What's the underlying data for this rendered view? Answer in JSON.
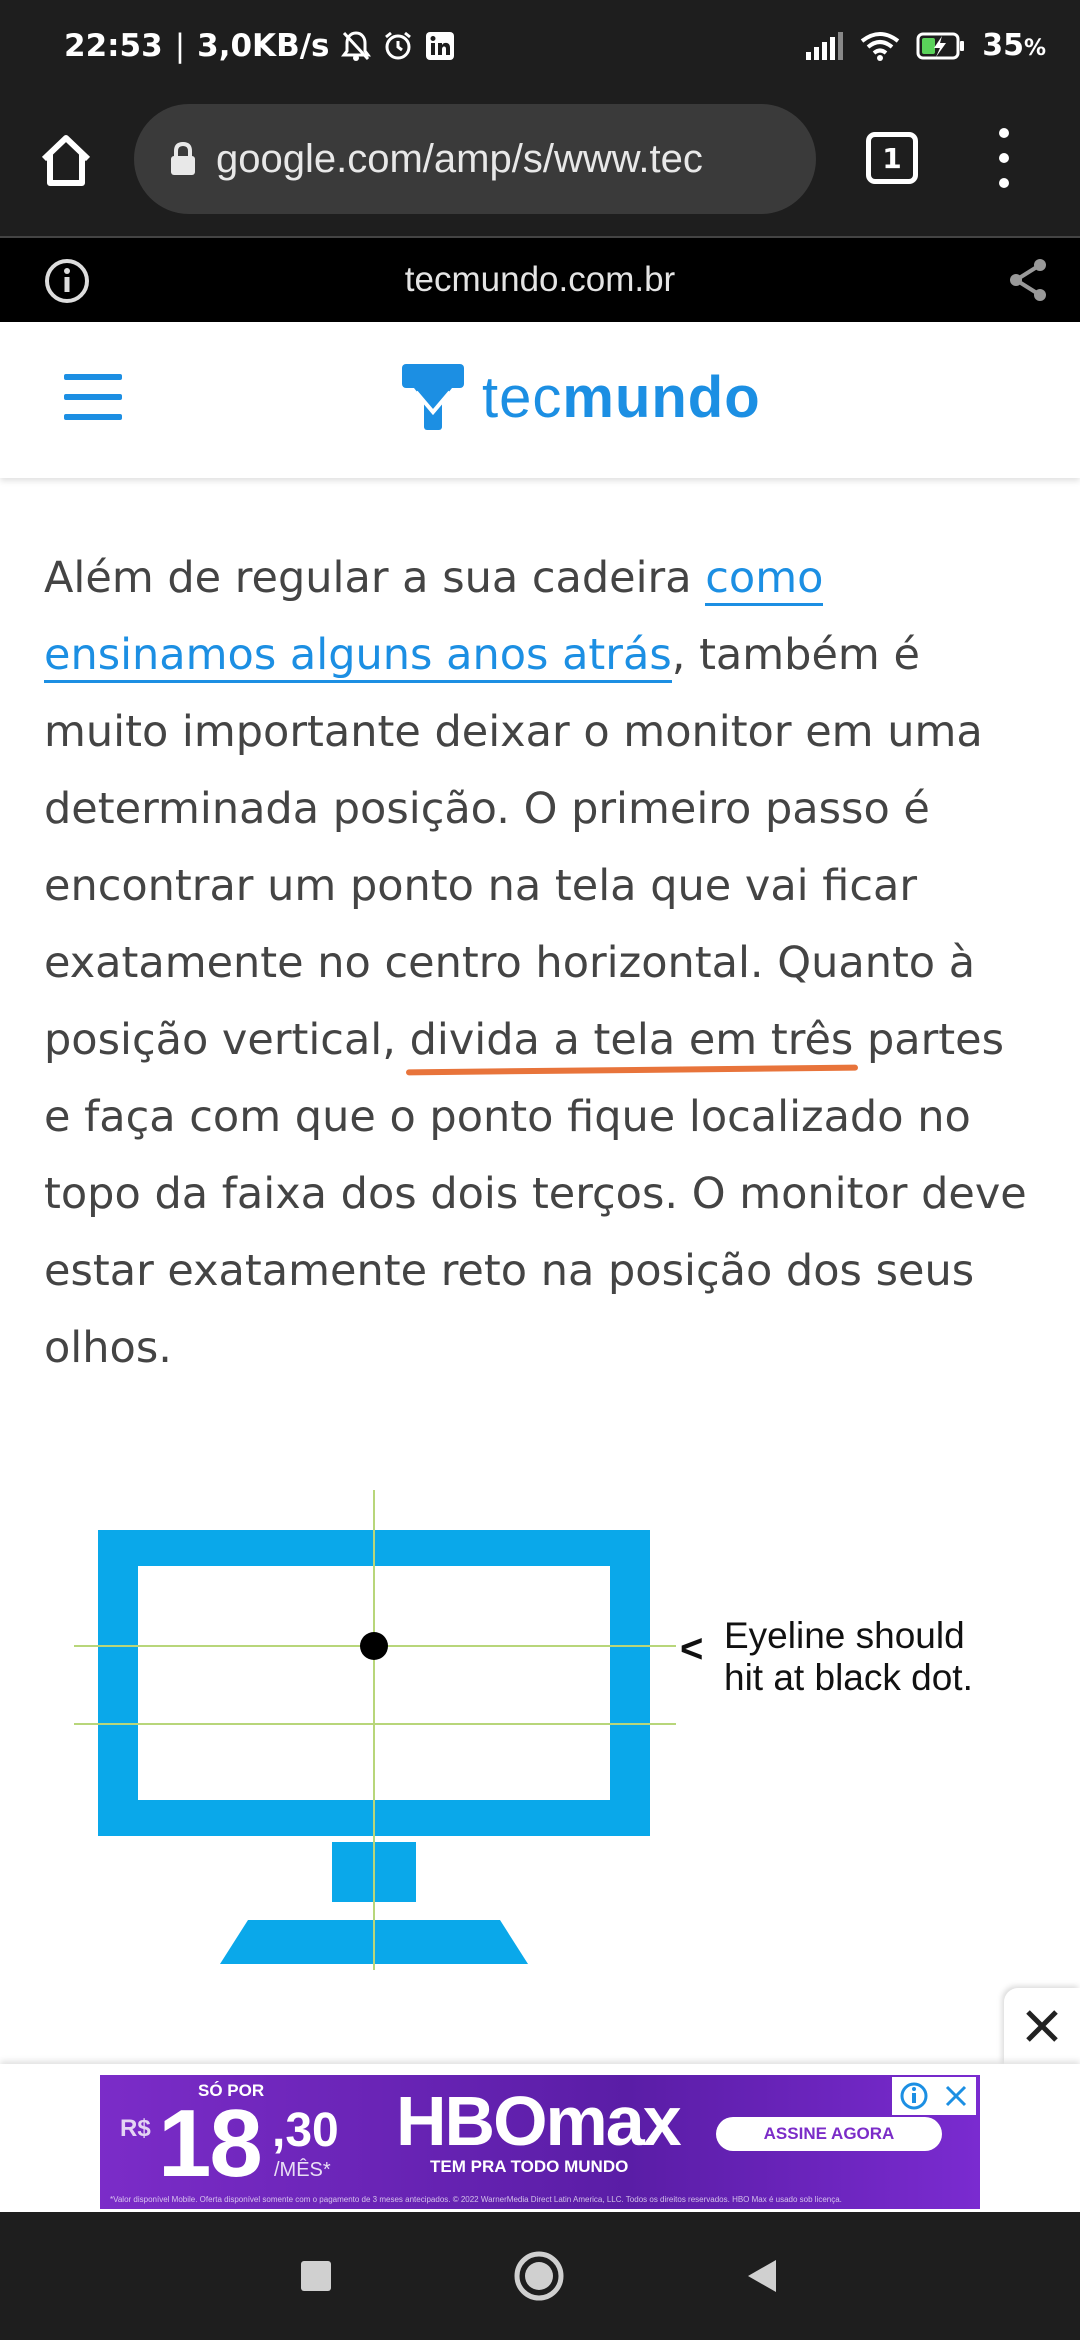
{
  "status_bar": {
    "time": "22:53",
    "speed": "3,0KB/s",
    "battery": "35",
    "battery_unit": "%",
    "icons": [
      "bell-off-icon",
      "alarm-icon",
      "linkedin-icon",
      "signal-icon",
      "wifi-icon",
      "battery-charging-icon"
    ]
  },
  "browser": {
    "url": "google.com/amp/s/www.tec",
    "tab_count": "1"
  },
  "amp_bar": {
    "domain": "tecmundo.com.br"
  },
  "site": {
    "logo_prefix": "tec",
    "logo_suffix": "mundo",
    "brand_color": "#1c8fe3"
  },
  "article": {
    "p1_before": "Além de regular a sua cadeira ",
    "p1_link": "como ensinamos alguns anos atrás",
    "p1_after": ", também é muito importante deixar o monitor em uma determinada posição. O primeiro passo é encontrar um ponto na tela que vai ficar exatamente no centro horizontal. Quanto à posição vertical, ",
    "p1_marked": "divida a tela em três",
    "p1_end": " partes e faça com que o ponto fique localizado no topo da faixa dos dois terços. O monitor deve estar exatamente reto na posição dos seus olhos."
  },
  "figure": {
    "caption_line1": "Eyeline should",
    "caption_line2": "hit at black dot.",
    "arrow": "<",
    "monitor_color": "#0aa8ea",
    "guide_color": "#b8d67a"
  },
  "ad": {
    "so_por": "SÓ POR",
    "currency": "R$",
    "price_int": "18",
    "price_cents": ",30",
    "per_month": "/MÊS*",
    "brand": "HBOmax",
    "tagline": "TEM PRA TODO MUNDO",
    "cta": "ASSINE AGORA",
    "fineprint": "*Valor disponível Mobile. Oferta disponível somente com o pagamento de 3 meses antecipados. © 2022 WarnerMedia Direct Latin America, LLC. Todos os direitos reservados. HBO Max é usado sob licença."
  }
}
